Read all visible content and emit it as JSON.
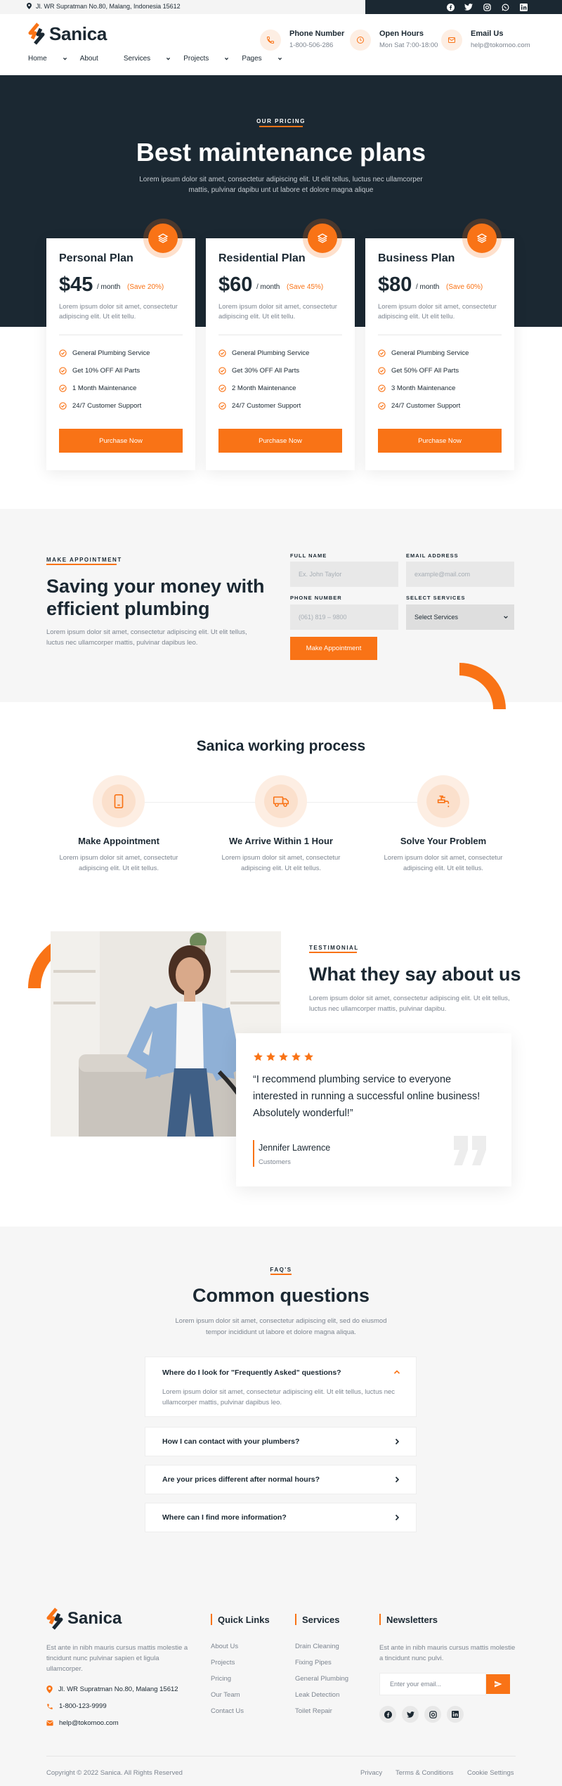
{
  "topbar": {
    "address": "Jl. WR Supratman No.80, Malang, Indonesia 15612",
    "social_icons": [
      "facebook-icon",
      "twitter-icon",
      "instagram-icon",
      "whatsapp-icon",
      "linkedin-icon"
    ]
  },
  "brand": {
    "name": "Sanica",
    "accent": "#f97316",
    "dark": "#1b2832"
  },
  "nav": [
    {
      "label": "Home",
      "dropdown": true
    },
    {
      "label": "About",
      "dropdown": false
    },
    {
      "label": "Services",
      "dropdown": true
    },
    {
      "label": "Projects",
      "dropdown": true
    },
    {
      "label": "Pages",
      "dropdown": true
    }
  ],
  "header_info": [
    {
      "title": "Phone Number",
      "value": "1-800-506-286",
      "icon": "phone-icon"
    },
    {
      "title": "Open Hours",
      "value": "Mon Sat 7:00-18:00",
      "icon": "clock-icon"
    },
    {
      "title": "Email Us",
      "value": "help@tokomoo.com",
      "icon": "mail-icon"
    }
  ],
  "pricing": {
    "eyebrow": "OUR PRICING",
    "title": "Best maintenance plans",
    "subtitle_1": "Lorem ipsum dolor sit amet, consectetur adipiscing elit. Ut elit tellus, luctus nec ullamcorper",
    "subtitle_2": "mattis, pulvinar dapibu unt ut labore et dolore magna alique",
    "plans": [
      {
        "name": "Personal Plan",
        "price": "$45",
        "per": "/ month",
        "save": "(Save 20%)",
        "desc": "Lorem ipsum dolor sit amet, consectetur adipiscing elit. Ut elit tellu.",
        "features": [
          "General Plumbing Service",
          "Get 10% OFF All Parts",
          "1 Month Maintenance",
          "24/7 Customer Support"
        ],
        "button": "Purchase Now"
      },
      {
        "name": "Residential Plan",
        "price": "$60",
        "per": "/ month",
        "save": "(Save 45%)",
        "desc": "Lorem ipsum dolor sit amet, consectetur adipiscing elit. Ut elit tellu.",
        "features": [
          "General Plumbing Service",
          "Get 30% OFF All Parts",
          "2 Month Maintenance",
          "24/7 Customer Support"
        ],
        "button": "Purchase Now"
      },
      {
        "name": "Business Plan",
        "price": "$80",
        "per": "/ month",
        "save": "(Save 60%)",
        "desc": "Lorem ipsum dolor sit amet, consectetur adipiscing elit. Ut elit tellu.",
        "features": [
          "General Plumbing Service",
          "Get 50% OFF All Parts",
          "3 Month Maintenance",
          "24/7 Customer Support"
        ],
        "button": "Purchase Now"
      }
    ]
  },
  "appointment": {
    "eyebrow": "MAKE APPOINTMENT",
    "title_1": "Saving your money with",
    "title_2": "efficient plumbing",
    "desc": "Lorem ipsum dolor sit amet, consectetur adipiscing elit. Ut elit tellus, luctus nec ullamcorper mattis, pulvinar dapibus leo.",
    "fields": {
      "name": {
        "label": "FULL NAME",
        "placeholder": "Ex. John Taylor"
      },
      "email": {
        "label": "EMAIL ADDRESS",
        "placeholder": "example@mail.com"
      },
      "phone": {
        "label": "PHONE NUMBER",
        "placeholder": "(061) 819 – 9800"
      },
      "service": {
        "label": "SELECT SERVICES",
        "value": "Select Services"
      }
    },
    "button": "Make Appointment"
  },
  "process": {
    "title": "Sanica working process",
    "steps": [
      {
        "title": "Make Appointment",
        "desc_1": "Lorem ipsum dolor sit amet, consectetur",
        "desc_2": "adipiscing elit. Ut elit tellus.",
        "icon": "phone-device-icon"
      },
      {
        "title": "We Arrive Within 1 Hour",
        "desc_1": "Lorem ipsum dolor sit amet, consectetur",
        "desc_2": "adipiscing elit. Ut elit tellus.",
        "icon": "truck-icon"
      },
      {
        "title": "Solve Your Problem",
        "desc_1": "Lorem ipsum dolor sit amet, consectetur",
        "desc_2": "adipiscing elit. Ut elit tellus.",
        "icon": "faucet-icon"
      }
    ]
  },
  "testimonial": {
    "eyebrow": "TESTIMONIAL",
    "title": "What they say about us",
    "desc": "Lorem ipsum dolor sit amet, consectetur adipiscing elit. Ut elit tellus, luctus nec ullamcorper mattis, pulvinar dapibu.",
    "rating": 5,
    "quote_1": "“I recommend plumbing service to everyone",
    "quote_2": "interested in running a successful online business!",
    "quote_3": "Absolutely wonderful!”",
    "author": "Jennifer Lawrence",
    "role": "Customers"
  },
  "faq": {
    "eyebrow": "FAQ'S",
    "title": "Common questions",
    "subtitle_1": "Lorem ipsum dolor sit amet, consectetur adipiscing elit, sed do eiusmod",
    "subtitle_2": "tempor incididunt ut labore et dolore magna aliqua.",
    "items": [
      {
        "q": "Where do I look for \"Frequently Asked\" questions?",
        "a": "Lorem ipsum dolor sit amet, consectetur adipiscing elit. Ut elit tellus, luctus nec ullamcorper mattis, pulvinar dapibus leo.",
        "open": true
      },
      {
        "q": "How I can contact with your plumbers?",
        "open": false
      },
      {
        "q": "Are your prices different after normal hours?",
        "open": false
      },
      {
        "q": "Where can I find more information?",
        "open": false
      }
    ]
  },
  "footer": {
    "about": "Est ante in nibh mauris cursus mattis molestie a tincidunt nunc pulvinar sapien et ligula ullamcorper.",
    "address": "Jl. WR Supratman No.80, Malang 15612",
    "phone": "1-800-123-9999",
    "email": "help@tokomoo.com",
    "quick_links": {
      "title": "Quick Links",
      "items": [
        "About Us",
        "Projects",
        "Pricing",
        "Our Team",
        "Contact Us"
      ]
    },
    "services": {
      "title": "Services",
      "items": [
        "Drain Cleaning",
        "Fixing Pipes",
        "General Plumbing",
        "Leak Detection",
        "Toilet Repair"
      ]
    },
    "newsletter": {
      "title": "Newsletters",
      "desc": "Est ante in nibh mauris cursus mattis molestie a tincidunt nunc pulvi.",
      "placeholder": "Enter your email..."
    },
    "copyright": "Copyright © 2022 Sanica. All Rights Reserved",
    "bottom_links": [
      "Privacy",
      "Terms & Conditions",
      "Cookie Settings"
    ]
  }
}
